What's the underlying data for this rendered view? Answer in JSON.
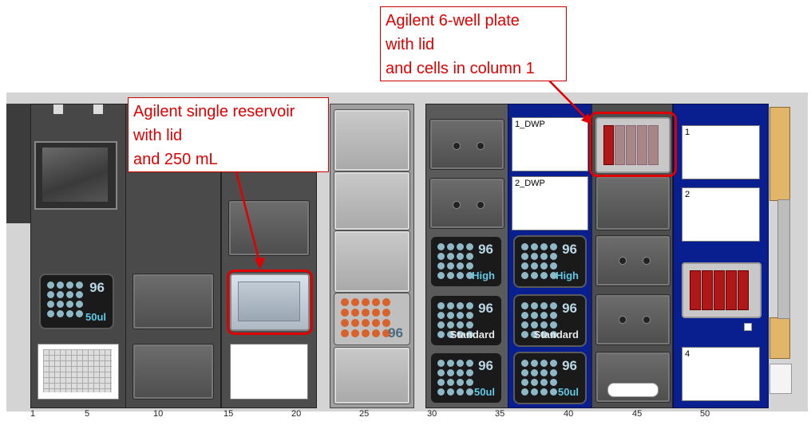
{
  "callouts": {
    "reservoir": {
      "line1": "Agilent single reservoir",
      "line2": "with lid",
      "line3": "and 250 mL"
    },
    "plate6": {
      "line1": "Agilent 6-well plate",
      "line2": "with lid",
      "line3": "and cells in column 1"
    }
  },
  "labware": {
    "tips_50ul_a": {
      "count": "96",
      "label": "50ul"
    },
    "tips_high_a": {
      "count": "96",
      "label": "High"
    },
    "tips_std_a": {
      "count": "96",
      "label": "Standard"
    },
    "tips_50ul_b": {
      "count": "96",
      "label": "50ul"
    },
    "tips_high_b": {
      "count": "96",
      "label": "High"
    },
    "tips_std_b": {
      "count": "96",
      "label": "Standard"
    },
    "tips_50ul_c": {
      "count": "96",
      "label": "50ul"
    },
    "plate_orange": {
      "count": "96"
    },
    "dwp1": "1_DWP",
    "dwp2": "2_DWP",
    "pos1": "1",
    "pos2": "2",
    "pos4": "4"
  },
  "ruler": [
    "1",
    "5",
    "10",
    "15",
    "20",
    "25",
    "30",
    "35",
    "40",
    "45",
    "50"
  ],
  "colors": {
    "accent_red": "#e00000",
    "carrier_blue": "#0a1f8f",
    "well_red": "#b01818"
  }
}
